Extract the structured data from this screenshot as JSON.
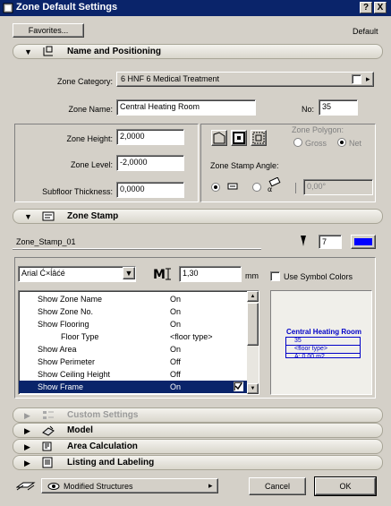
{
  "window": {
    "title": "Zone Default Settings",
    "help": "?",
    "close": "X"
  },
  "toolbar": {
    "favorites": "Favorites...",
    "default_label": "Default"
  },
  "name_section": {
    "title": "Name and Positioning"
  },
  "zone": {
    "category_label": "Zone Category:",
    "category_value": "6 HNF   6 Medical Treatment",
    "name_label": "Zone Name:",
    "name_value": "Central Heating Room",
    "no_label": "No:",
    "no_value": "35",
    "height_label": "Zone Height:",
    "height_value": "2,0000",
    "level_label": "Zone Level:",
    "level_value": "-2,0000",
    "subfloor_label": "Subfloor Thickness:",
    "subfloor_value": "0,0000",
    "polygon_label": "Zone Polygon:",
    "polygon_gross": "Gross",
    "polygon_net": "Net",
    "stamp_angle_label": "Zone Stamp Angle:",
    "angle_value": "0,00°"
  },
  "stamp_section": {
    "title": "Zone Stamp"
  },
  "stamp": {
    "name": "Zone_Stamp_01",
    "pen_value": "7",
    "pen_color": "#0000ff",
    "font_value": "Arial Ć×ĺâćé",
    "size_value": "1,30",
    "unit": "mm",
    "use_symbol_colors": "Use Symbol Colors"
  },
  "params": [
    {
      "key": "Show Zone Name",
      "value": "On"
    },
    {
      "key": "Show Zone No.",
      "value": "On"
    },
    {
      "key": "Show Flooring",
      "value": "On"
    },
    {
      "key": "Floor Type",
      "value": "<floor type>"
    },
    {
      "key": "Show Area",
      "value": "On"
    },
    {
      "key": "Show Perimeter",
      "value": "Off"
    },
    {
      "key": "Show Ceiling Height",
      "value": "Off"
    },
    {
      "key": "Show Frame",
      "value": "On"
    }
  ],
  "preview": {
    "title": "Central Heating Room",
    "no": "35",
    "floor": "<floor type>",
    "area": "A: 0.00 m2"
  },
  "sections": {
    "custom": "Custom Settings",
    "model": "Model",
    "area": "Area Calculation",
    "listing": "Listing and Labeling"
  },
  "footer": {
    "layer": "Modified Structures",
    "cancel": "Cancel",
    "ok": "OK"
  }
}
